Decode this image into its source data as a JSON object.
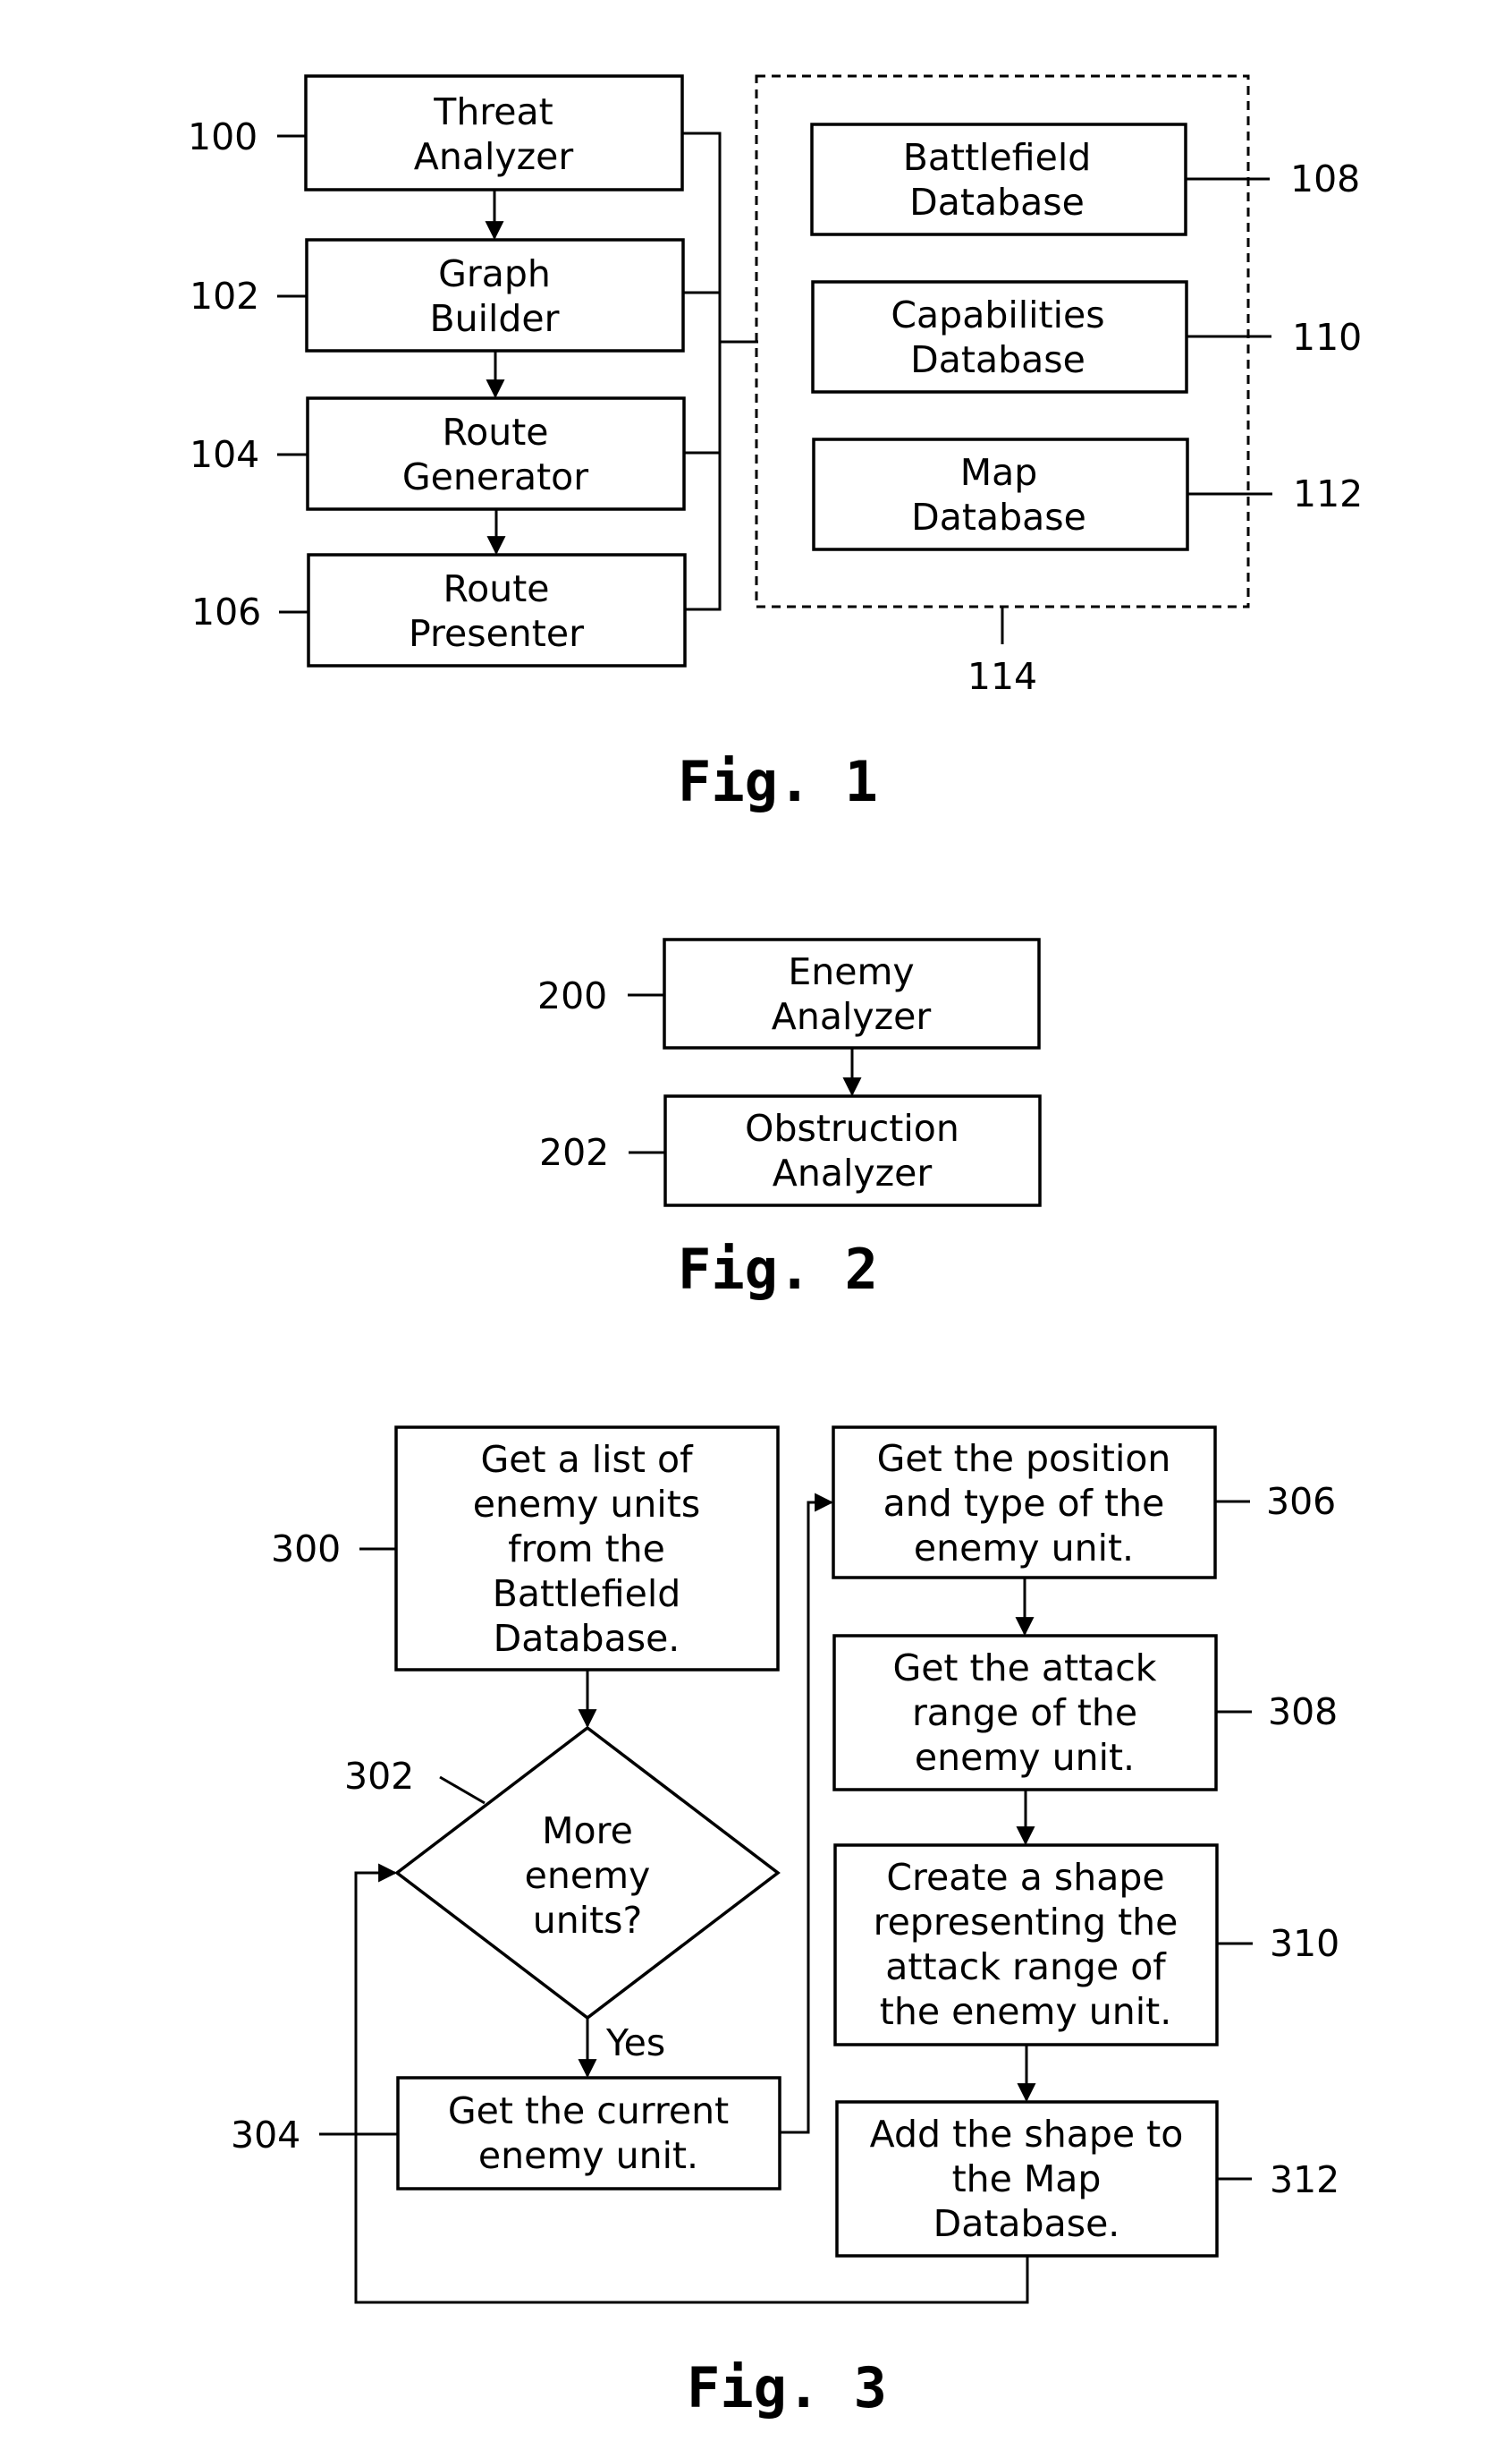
{
  "figures": {
    "fig1": {
      "caption": "Fig. 1",
      "modules": [
        {
          "ref": "100",
          "lines": [
            "Threat",
            "Analyzer"
          ]
        },
        {
          "ref": "102",
          "lines": [
            "Graph",
            "Builder"
          ]
        },
        {
          "ref": "104",
          "lines": [
            "Route",
            "Generator"
          ]
        },
        {
          "ref": "106",
          "lines": [
            "Route",
            "Presenter"
          ]
        }
      ],
      "databases": [
        {
          "ref": "108",
          "lines": [
            "Battlefield",
            "Database"
          ]
        },
        {
          "ref": "110",
          "lines": [
            "Capabilities",
            "Database"
          ]
        },
        {
          "ref": "112",
          "lines": [
            "Map",
            "Database"
          ]
        }
      ],
      "database_group_ref": "114"
    },
    "fig2": {
      "caption": "Fig. 2",
      "modules": [
        {
          "ref": "200",
          "lines": [
            "Enemy",
            "Analyzer"
          ]
        },
        {
          "ref": "202",
          "lines": [
            "Obstruction",
            "Analyzer"
          ]
        }
      ]
    },
    "fig3": {
      "caption": "Fig. 3",
      "steps": {
        "s300": {
          "ref": "300",
          "lines": [
            "Get a list of",
            "enemy units",
            "from the",
            "Battlefield",
            "Database."
          ]
        },
        "s302": {
          "ref": "302",
          "lines": [
            "More",
            "enemy",
            "units?"
          ]
        },
        "s304": {
          "ref": "304",
          "lines": [
            "Get the current",
            "enemy unit."
          ]
        },
        "s306": {
          "ref": "306",
          "lines": [
            "Get the position",
            "and type of the",
            "enemy unit."
          ]
        },
        "s308": {
          "ref": "308",
          "lines": [
            "Get the attack",
            "range of the",
            "enemy unit."
          ]
        },
        "s310": {
          "ref": "310",
          "lines": [
            "Create a shape",
            "representing the",
            "attack range of",
            "the enemy unit."
          ]
        },
        "s312": {
          "ref": "312",
          "lines": [
            "Add the shape to",
            "the Map",
            "Database."
          ]
        }
      },
      "yes_label": "Yes"
    }
  }
}
